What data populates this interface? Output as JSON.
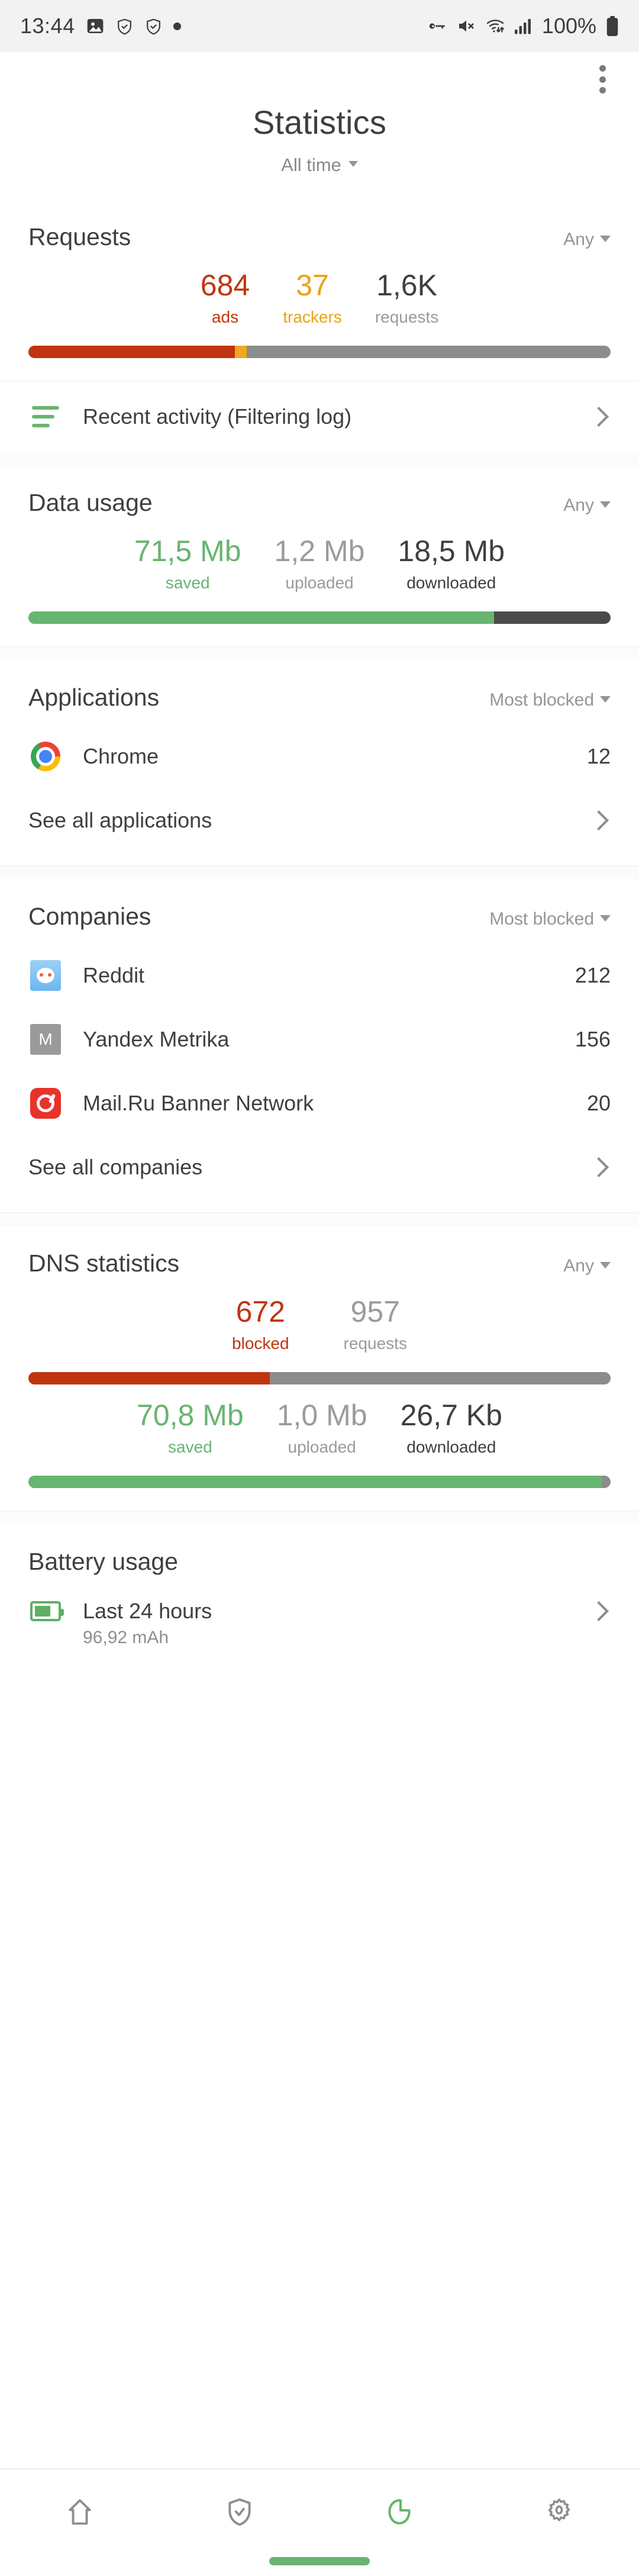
{
  "status_bar": {
    "time": "13:44",
    "battery_percent": "100%",
    "left_icons": [
      "photo-icon",
      "shield-check-icon",
      "shield-check-icon",
      "dot-icon"
    ],
    "right_icons": [
      "vpn-key-icon",
      "mute-icon",
      "wifi-icon",
      "cellular-signal-icon",
      "battery-icon"
    ]
  },
  "app_bar": {
    "menu_icon": "overflow-menu-icon",
    "title": "Statistics",
    "time_range": "All time"
  },
  "requests": {
    "title": "Requests",
    "filter": "Any",
    "stats": [
      {
        "value": "684",
        "label": "ads",
        "color": "#c0350f"
      },
      {
        "value": "37",
        "label": "trackers",
        "color": "#e8a317"
      },
      {
        "value": "1,6K",
        "label": "requests",
        "color": "#3f3f3f"
      }
    ],
    "bar": {
      "segments": [
        {
          "name": "ads",
          "percent": 35.5,
          "color": "#c0350f"
        },
        {
          "name": "trackers",
          "percent": 2.0,
          "color": "#f0a91e"
        },
        {
          "name": "other",
          "percent": 62.5,
          "color": "#8c8c8c"
        }
      ]
    }
  },
  "recent_activity": {
    "icon": "filter-log-icon",
    "label": "Recent activity (Filtering log)",
    "chevron": "chevron-right-icon"
  },
  "data_usage": {
    "title": "Data usage",
    "filter": "Any",
    "stats": [
      {
        "value": "71,5 Mb",
        "label": "saved",
        "color": "#67b56f"
      },
      {
        "value": "1,2 Mb",
        "label": "uploaded",
        "color": "#9b9b9b"
      },
      {
        "value": "18,5 Mb",
        "label": "downloaded",
        "color": "#3f3f3f"
      }
    ],
    "bar": {
      "segments": [
        {
          "name": "saved",
          "percent": 80.0,
          "color": "#67b56f"
        },
        {
          "name": "used",
          "percent": 20.0,
          "color": "#4a4a4a"
        }
      ]
    }
  },
  "applications": {
    "title": "Applications",
    "filter": "Most blocked",
    "items": [
      {
        "icon": "chrome-icon",
        "name": "Chrome",
        "count": "12"
      }
    ],
    "see_all": "See all applications"
  },
  "companies": {
    "title": "Companies",
    "filter": "Most blocked",
    "items": [
      {
        "icon": "reddit-icon",
        "name": "Reddit",
        "count": "212"
      },
      {
        "icon": "metrika-icon",
        "name": "Yandex Metrika",
        "count": "156"
      },
      {
        "icon": "mailru-icon",
        "name": "Mail.Ru Banner Network",
        "count": "20"
      }
    ],
    "see_all": "See all companies"
  },
  "dns_statistics": {
    "title": "DNS statistics",
    "filter": "Any",
    "stats_requests": [
      {
        "value": "672",
        "label": "blocked",
        "color": "#c0350f"
      },
      {
        "value": "957",
        "label": "requests",
        "color": "#9b9b9b"
      }
    ],
    "bar_requests": {
      "segments": [
        {
          "name": "blocked",
          "percent": 41.5,
          "color": "#c0350f"
        },
        {
          "name": "allowed",
          "percent": 58.5,
          "color": "#8c8c8c"
        }
      ]
    },
    "stats_data": [
      {
        "value": "70,8 Mb",
        "label": "saved",
        "color": "#67b56f"
      },
      {
        "value": "1,0 Mb",
        "label": "uploaded",
        "color": "#9b9b9b"
      },
      {
        "value": "26,7 Kb",
        "label": "downloaded",
        "color": "#3f3f3f"
      }
    ],
    "bar_data": {
      "segments": [
        {
          "name": "saved",
          "percent": 98.5,
          "color": "#67b56f"
        },
        {
          "name": "used",
          "percent": 1.5,
          "color": "#8c8c8c"
        }
      ]
    }
  },
  "battery_usage": {
    "title": "Battery usage",
    "icon": "battery-usage-icon",
    "label": "Last 24 hours",
    "value": "96,92 mAh"
  },
  "bottom_nav": {
    "items": [
      {
        "icon": "home-icon",
        "active": false
      },
      {
        "icon": "shield-check-icon",
        "active": false
      },
      {
        "icon": "pie-chart-icon",
        "active": true
      },
      {
        "icon": "gear-icon",
        "active": false
      }
    ],
    "active_color": "#67b56f",
    "inactive_color": "#8d8d8d"
  },
  "chart_data": [
    {
      "type": "bar",
      "title": "Requests",
      "categories": [
        "ads",
        "trackers",
        "requests"
      ],
      "values": [
        684,
        37,
        1600
      ],
      "stacked_percent": [
        35.5,
        2.0,
        62.5
      ],
      "colors": [
        "#c0350f",
        "#f0a91e",
        "#8c8c8c"
      ]
    },
    {
      "type": "bar",
      "title": "Data usage",
      "categories": [
        "saved",
        "uploaded",
        "downloaded"
      ],
      "values": [
        71.5,
        1.2,
        18.5
      ],
      "unit": "Mb",
      "stacked_percent": [
        80.0,
        20.0
      ],
      "colors": [
        "#67b56f",
        "#4a4a4a"
      ]
    },
    {
      "type": "bar",
      "title": "Applications (Most blocked)",
      "categories": [
        "Chrome"
      ],
      "values": [
        12
      ]
    },
    {
      "type": "bar",
      "title": "Companies (Most blocked)",
      "categories": [
        "Reddit",
        "Yandex Metrika",
        "Mail.Ru Banner Network"
      ],
      "values": [
        212,
        156,
        20
      ]
    },
    {
      "type": "bar",
      "title": "DNS statistics",
      "categories": [
        "blocked",
        "requests"
      ],
      "values": [
        672,
        957
      ],
      "stacked_percent": [
        41.5,
        58.5
      ],
      "colors": [
        "#c0350f",
        "#8c8c8c"
      ]
    },
    {
      "type": "bar",
      "title": "DNS data usage",
      "categories": [
        "saved",
        "uploaded",
        "downloaded"
      ],
      "values": [
        70.8,
        1.0,
        26.7
      ],
      "units": [
        "Mb",
        "Mb",
        "Kb"
      ],
      "stacked_percent": [
        98.5,
        1.5
      ],
      "colors": [
        "#67b56f",
        "#8c8c8c"
      ]
    }
  ]
}
